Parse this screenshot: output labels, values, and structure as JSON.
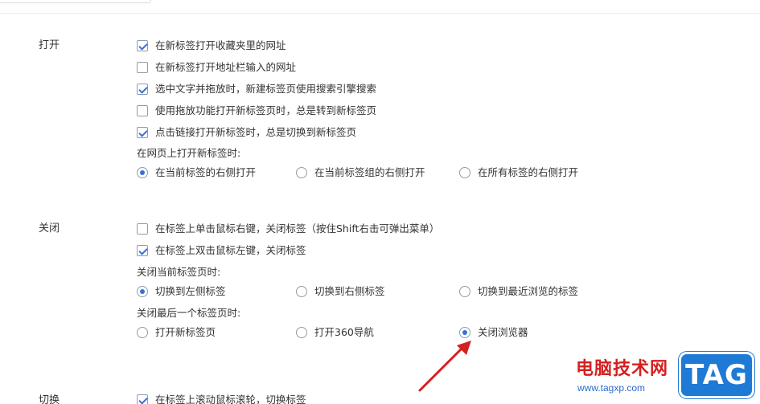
{
  "sections": {
    "open": {
      "title": "打开",
      "options": [
        {
          "label": "在新标签打开收藏夹里的网址",
          "checked": true
        },
        {
          "label": "在新标签打开地址栏输入的网址",
          "checked": false
        },
        {
          "label": "选中文字并拖放时，新建标签页使用搜索引擎搜索",
          "checked": true
        },
        {
          "label": "使用拖放功能打开新标签页时，总是转到新标签页",
          "checked": false
        },
        {
          "label": "点击链接打开新标签时，总是切换到新标签页",
          "checked": true
        }
      ],
      "group_heading": "在网页上打开新标签时:",
      "radios": [
        {
          "label": "在当前标签的右侧打开",
          "checked": true
        },
        {
          "label": "在当前标签组的右侧打开",
          "checked": false
        },
        {
          "label": "在所有标签的右侧打开",
          "checked": false
        }
      ]
    },
    "close": {
      "title": "关闭",
      "options": [
        {
          "label": "在标签上单击鼠标右键，关闭标签（按住Shift右击可弹出菜单）",
          "checked": false
        },
        {
          "label": "在标签上双击鼠标左键，关闭标签",
          "checked": true
        }
      ],
      "group1_heading": "关闭当前标签页时:",
      "group1_radios": [
        {
          "label": "切换到左侧标签",
          "checked": true
        },
        {
          "label": "切换到右侧标签",
          "checked": false
        },
        {
          "label": "切换到最近浏览的标签",
          "checked": false
        }
      ],
      "group2_heading": "关闭最后一个标签页时:",
      "group2_radios": [
        {
          "label": "打开新标签页",
          "checked": false
        },
        {
          "label": "打开360导航",
          "checked": false
        },
        {
          "label": "关闭浏览器",
          "checked": true
        }
      ]
    },
    "switch": {
      "title": "切换",
      "options": [
        {
          "label": "在标签上滚动鼠标滚轮，切换标签",
          "checked": true
        }
      ]
    }
  },
  "watermark": {
    "name": "电脑技术网",
    "url": "www.tagxp.com",
    "badge": "TAG"
  },
  "colors": {
    "accent": "#3b6fd6",
    "arrow": "#d42020",
    "badge": "#1f7ad6"
  }
}
